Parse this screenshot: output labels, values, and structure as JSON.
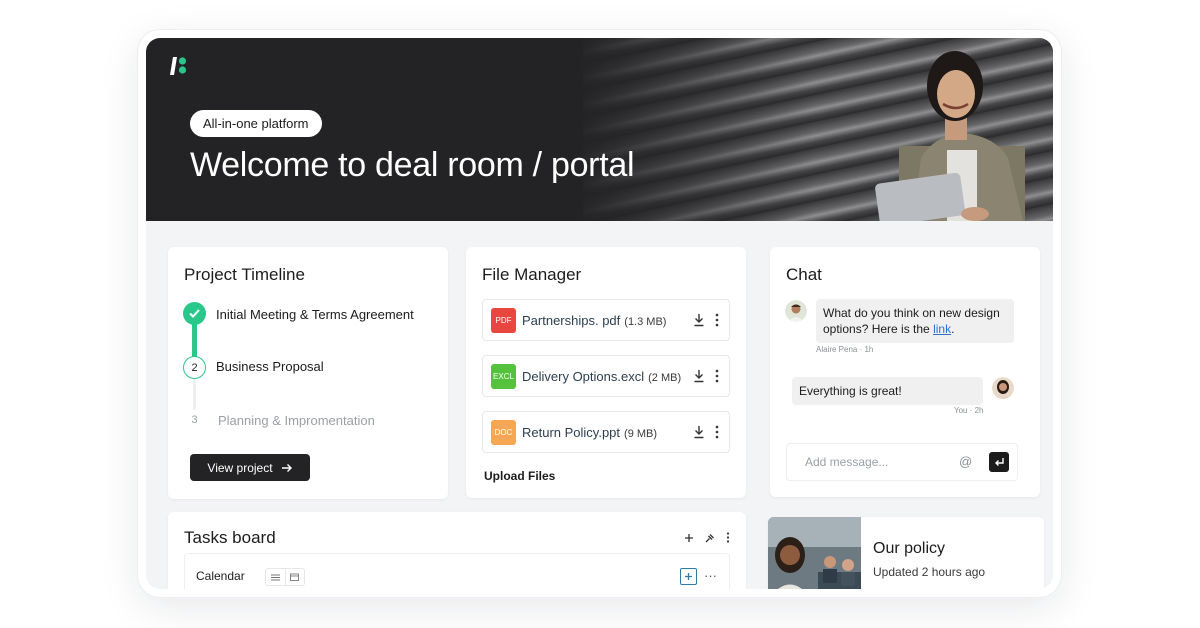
{
  "hero": {
    "badge": "All-in-one platform",
    "title": "Welcome to deal room / portal"
  },
  "timeline": {
    "title": "Project Timeline",
    "steps": [
      {
        "number": "1",
        "label": "Initial Meeting & Terms Agreement",
        "status": "done"
      },
      {
        "number": "2",
        "label": "Business Proposal",
        "status": "current"
      },
      {
        "number": "3",
        "label": "Planning & Impromentation",
        "status": "upcoming"
      }
    ],
    "button_label": "View project"
  },
  "files": {
    "title": "File Manager",
    "items": [
      {
        "tag": "PDF",
        "name": "Partnerships. pdf",
        "size": "(1.3 MB)",
        "color": "#e8473f"
      },
      {
        "tag": "EXCL",
        "name": "Delivery Options.excl",
        "size": "(2 MB)",
        "color": "#55c23e"
      },
      {
        "tag": "DOC",
        "name": "Return Policy.ppt",
        "size": "(9 MB)",
        "color": "#f7a651"
      }
    ],
    "upload_label": "Upload Files"
  },
  "chat": {
    "title": "Chat",
    "messages": [
      {
        "text": "What do you think on new design options? Here is the ",
        "link": "link",
        "after": ".",
        "meta": "Alaire Pena · 1h"
      },
      {
        "text": "Everything is great!",
        "meta": "You · 2h"
      }
    ],
    "input_placeholder": "Add message...",
    "at_symbol": "@"
  },
  "tasks": {
    "title": "Tasks board",
    "row_label": "Calendar"
  },
  "policy": {
    "title": "Our policy",
    "updated": "Updated 2 hours ago"
  },
  "colors": {
    "accent_green": "#2bc68a",
    "dark": "#232325",
    "link": "#2b6fd6"
  }
}
